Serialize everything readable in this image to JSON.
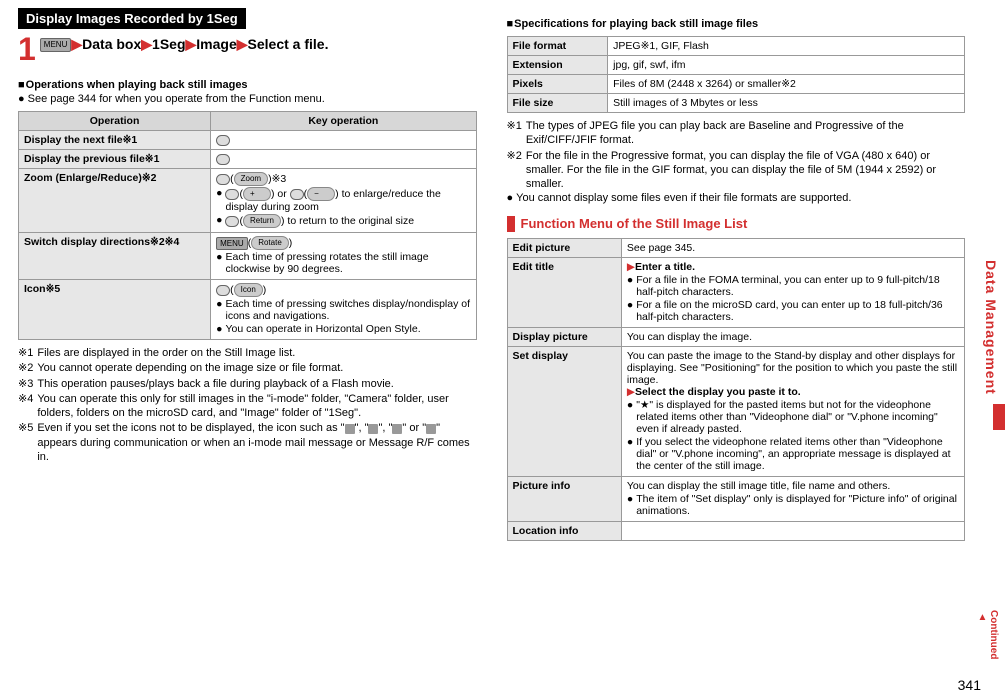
{
  "left": {
    "headerBar": "Display Images Recorded by 1Seg",
    "step": {
      "num": "1",
      "menu": "MENU",
      "parts": [
        "Data box",
        "1Seg",
        "Image",
        "Select a file."
      ]
    },
    "opHeading": "Operations when playing back still images",
    "opNote": "See page 344 for when you operate from the Function menu.",
    "opTable": {
      "header": [
        "Operation",
        "Key operation"
      ],
      "rows": [
        {
          "label": "Display the next file※1",
          "key": ""
        },
        {
          "label": "Display the previous file※1",
          "key": ""
        },
        {
          "label": "Zoom (Enlarge/Reduce)※2",
          "pill1": "Zoom",
          "sup1": "※3",
          "pill2": "+",
          "mid": " or ",
          "pill3": "−",
          "line2_tail": " to enlarge/reduce the display during zoom",
          "pill4": "Return",
          "line3_tail": " to return to the original size"
        },
        {
          "label": "Switch display directions※2※4",
          "menu": "MENU",
          "pill": "Rotate",
          "line2": "Each time of pressing rotates the still image clockwise by 90 degrees."
        },
        {
          "label": "Icon※5",
          "pill": "Icon",
          "line2": "Each time of pressing switches display/nondisplay of icons and navigations.",
          "line3": "You can operate in Horizontal Open Style."
        }
      ]
    },
    "notes": [
      {
        "k": "※1",
        "t": "Files are displayed in the order on the Still Image list."
      },
      {
        "k": "※2",
        "t": "You cannot operate depending on the image size or file format."
      },
      {
        "k": "※3",
        "t": "This operation pauses/plays back a file during playback of a Flash movie."
      },
      {
        "k": "※4",
        "t": "You can operate this only for still images in the \"i-mode\" folder, \"Camera\" folder, user folders, folders on the microSD card, and \"Image\" folder of \"1Seg\"."
      },
      {
        "k": "※5",
        "t": "Even if you set the icons not to be displayed, the icon such as \" \", \" \", \" \" or \" \" appears during communication or when an i-mode mail message or Message R/F comes in."
      }
    ]
  },
  "right": {
    "specHeading": "Specifications for playing back still image files",
    "specTable": [
      {
        "k": "File format",
        "v": "JPEG※1, GIF, Flash"
      },
      {
        "k": "Extension",
        "v": "jpg, gif, swf, ifm"
      },
      {
        "k": "Pixels",
        "v": "Files of 8M (2448 x 3264) or smaller※2"
      },
      {
        "k": "File size",
        "v": "Still images of 3 Mbytes or less"
      }
    ],
    "specNotes": [
      {
        "k": "※1",
        "t": "The types of JPEG file you can play back are Baseline and Progressive of the Exif/CIFF/JFIF format."
      },
      {
        "k": "※2",
        "t": "For the file in the Progressive format, you can display the file of VGA (480 x 640) or smaller. For the file in the GIF format, you can display the file of 5M (1944 x 2592) or smaller."
      }
    ],
    "specExtra": "You cannot display some files even if their file formats are supported.",
    "funcTitle": "Function Menu of the Still Image List",
    "funcTable": [
      {
        "k": "Edit picture",
        "lines": [
          "See page 345."
        ]
      },
      {
        "k": "Edit title",
        "action": "Enter a title.",
        "lines": [
          "For a file in the FOMA terminal, you can enter up to 9 full-pitch/18 half-pitch characters.",
          "For a file on the microSD card, you can enter up to 18 full-pitch/36 half-pitch characters."
        ]
      },
      {
        "k": "Display picture",
        "lines": [
          "You can display the image."
        ]
      },
      {
        "k": "Set display",
        "plain": "You can paste the image to the Stand-by display and other displays for displaying. See \"Positioning\" for the position to which you paste the still image.",
        "action": "Select the display you paste it to.",
        "lines": [
          "\"★\" is displayed for the pasted items but not for the videophone related items other than \"Videophone dial\" or \"V.phone incoming\" even if already pasted.",
          "If you select the videophone related items other than \"Videophone dial\" or \"V.phone incoming\", an appropriate message is displayed at the center of the still image."
        ]
      },
      {
        "k": "Picture info",
        "plain": "You can display the still image title, file name and others.",
        "lines": [
          "The item of \"Set display\" only is displayed for \"Picture info\" of original animations."
        ]
      },
      {
        "k": "Location info",
        "lines": []
      }
    ]
  },
  "sideTab": "Data Management",
  "continued": "Continued",
  "pageNum": "341"
}
